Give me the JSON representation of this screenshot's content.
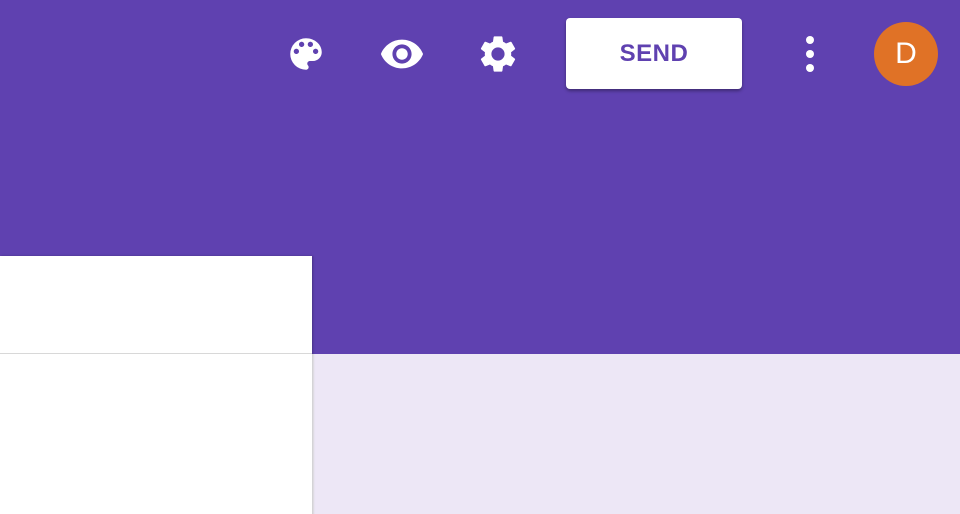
{
  "colors": {
    "header_purple": "#5f41b0",
    "background_lavender": "#ede7f6",
    "avatar_orange": "#e07226",
    "icon_white": "#ffffff"
  },
  "toolbar": {
    "icons": [
      "palette-icon",
      "eye-icon",
      "gear-icon",
      "more-vert-icon"
    ],
    "send_label": "SEND"
  },
  "account": {
    "avatar_letter": "D"
  }
}
